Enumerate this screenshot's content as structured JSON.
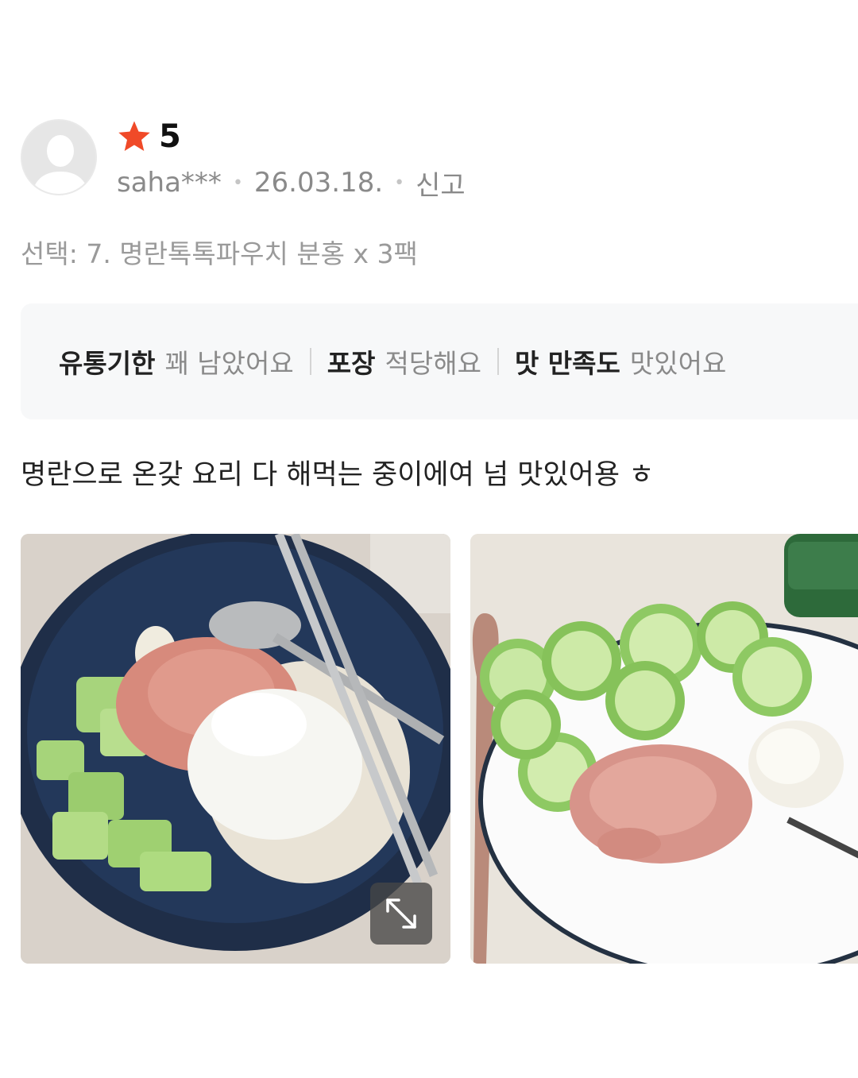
{
  "review": {
    "avatar_icon": "default-user-avatar-icon",
    "rating": {
      "star_icon": "star-icon",
      "star_color": "#f04a28",
      "value": "5"
    },
    "author": "saha***",
    "date": "26.03.18.",
    "report_label": "신고",
    "option_text": "선택: 7. 명란톡톡파우치 분홍 x 3팩",
    "attributes": [
      {
        "key": "유통기한",
        "value": "꽤 남았어요"
      },
      {
        "key": "포장",
        "value": "적당해요"
      },
      {
        "key": "맛 만족도",
        "value": "맛있어요"
      }
    ],
    "text": "명란으로 온갖 요리 다 해먹는 중이에여 넘 맛있어용 ㅎ",
    "photos": [
      {
        "name": "rice-bowl-with-mentaiko-egg-cucumber-photo"
      },
      {
        "name": "plate-with-mentaiko-cucumber-mayo-photo"
      }
    ],
    "expand_icon": "expand-arrows-icon"
  }
}
